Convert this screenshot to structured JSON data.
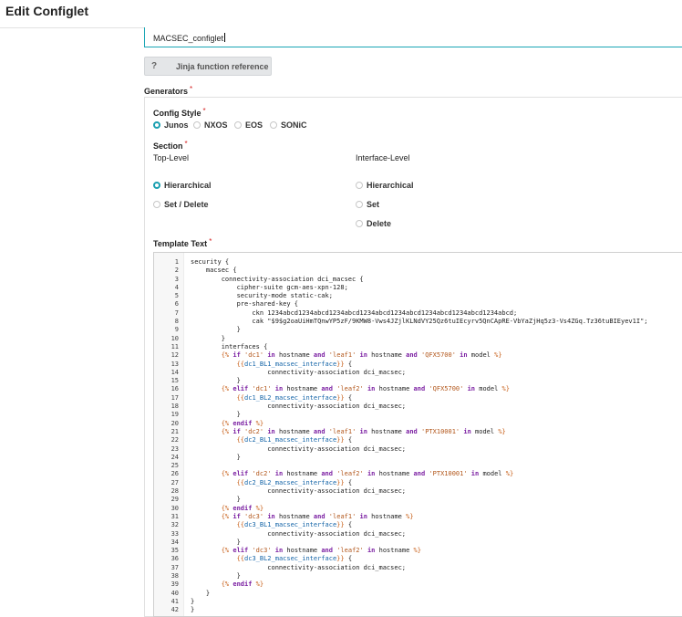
{
  "page": {
    "title": "Edit Configlet"
  },
  "name_field": {
    "value": "MACSEC_configlet"
  },
  "jinja_button": {
    "icon": "?",
    "label": "Jinja function reference"
  },
  "generators": {
    "label": "Generators",
    "config_style": {
      "label": "Config Style",
      "options": [
        {
          "label": "Junos",
          "selected": true
        },
        {
          "label": "NXOS",
          "selected": false
        },
        {
          "label": "EOS",
          "selected": false
        },
        {
          "label": "SONiC",
          "selected": false
        }
      ]
    },
    "section": {
      "label": "Section",
      "top_level": {
        "label": "Top-Level",
        "options": [
          {
            "label": "Hierarchical",
            "selected": true
          },
          {
            "label": "Set / Delete",
            "selected": false
          }
        ]
      },
      "interface_level": {
        "label": "Interface-Level",
        "options": [
          {
            "label": "Hierarchical",
            "selected": false
          },
          {
            "label": "Set",
            "selected": false
          },
          {
            "label": "Delete",
            "selected": false
          }
        ]
      }
    },
    "template_text_label": "Template Text"
  },
  "required_mark": "*",
  "code_lines": [
    "security {",
    "    macsec {",
    "        connectivity-association dci_macsec {",
    "            cipher-suite gcm-aes-xpn-128;",
    "            security-mode static-cak;",
    "            pre-shared-key {",
    "                ckn 1234abcd1234abcd1234abcd1234abcd1234abcd1234abcd1234abcd1234abcd;",
    "                cak \"$9$g2oaUiHmTQnwYP5zF/9KMW8-Vws4JZjlKLNdVY25Qz6tuIEcyrv5QnCApRE-VbYaZjHq5z3-Vs4ZGq.Tz36tuBIEyev1I\";",
    "            }",
    "        }",
    "        interfaces {",
    "        {% if 'dc1' in hostname and 'leaf1' in hostname and 'QFX5700' in model %}",
    "            {{dc1_BL1_macsec_interface}} {",
    "                    connectivity-association dci_macsec;",
    "            }",
    "        {% elif 'dc1' in hostname and 'leaf2' in hostname and 'QFX5700' in model %}",
    "            {{dc1_BL2_macsec_interface}} {",
    "                    connectivity-association dci_macsec;",
    "            }",
    "        {% endif %}",
    "        {% if 'dc2' in hostname and 'leaf1' in hostname and 'PTX10001' in model %}",
    "            {{dc2_BL1_macsec_interface}} {",
    "                    connectivity-association dci_macsec;",
    "            }",
    "",
    "        {% elif 'dc2' in hostname and 'leaf2' in hostname and 'PTX10001' in model %}",
    "            {{dc2_BL2_macsec_interface}} {",
    "                    connectivity-association dci_macsec;",
    "            }",
    "        {% endif %}",
    "        {% if 'dc3' in hostname and 'leaf1' in hostname %}",
    "            {{dc3_BL1_macsec_interface}} {",
    "                    connectivity-association dci_macsec;",
    "            }",
    "        {% elif 'dc3' in hostname and 'leaf2' in hostname %}",
    "            {{dc3_BL2_macsec_interface}} {",
    "                    connectivity-association dci_macsec;",
    "            }",
    "        {% endif %}",
    "    }",
    "}",
    "}"
  ]
}
